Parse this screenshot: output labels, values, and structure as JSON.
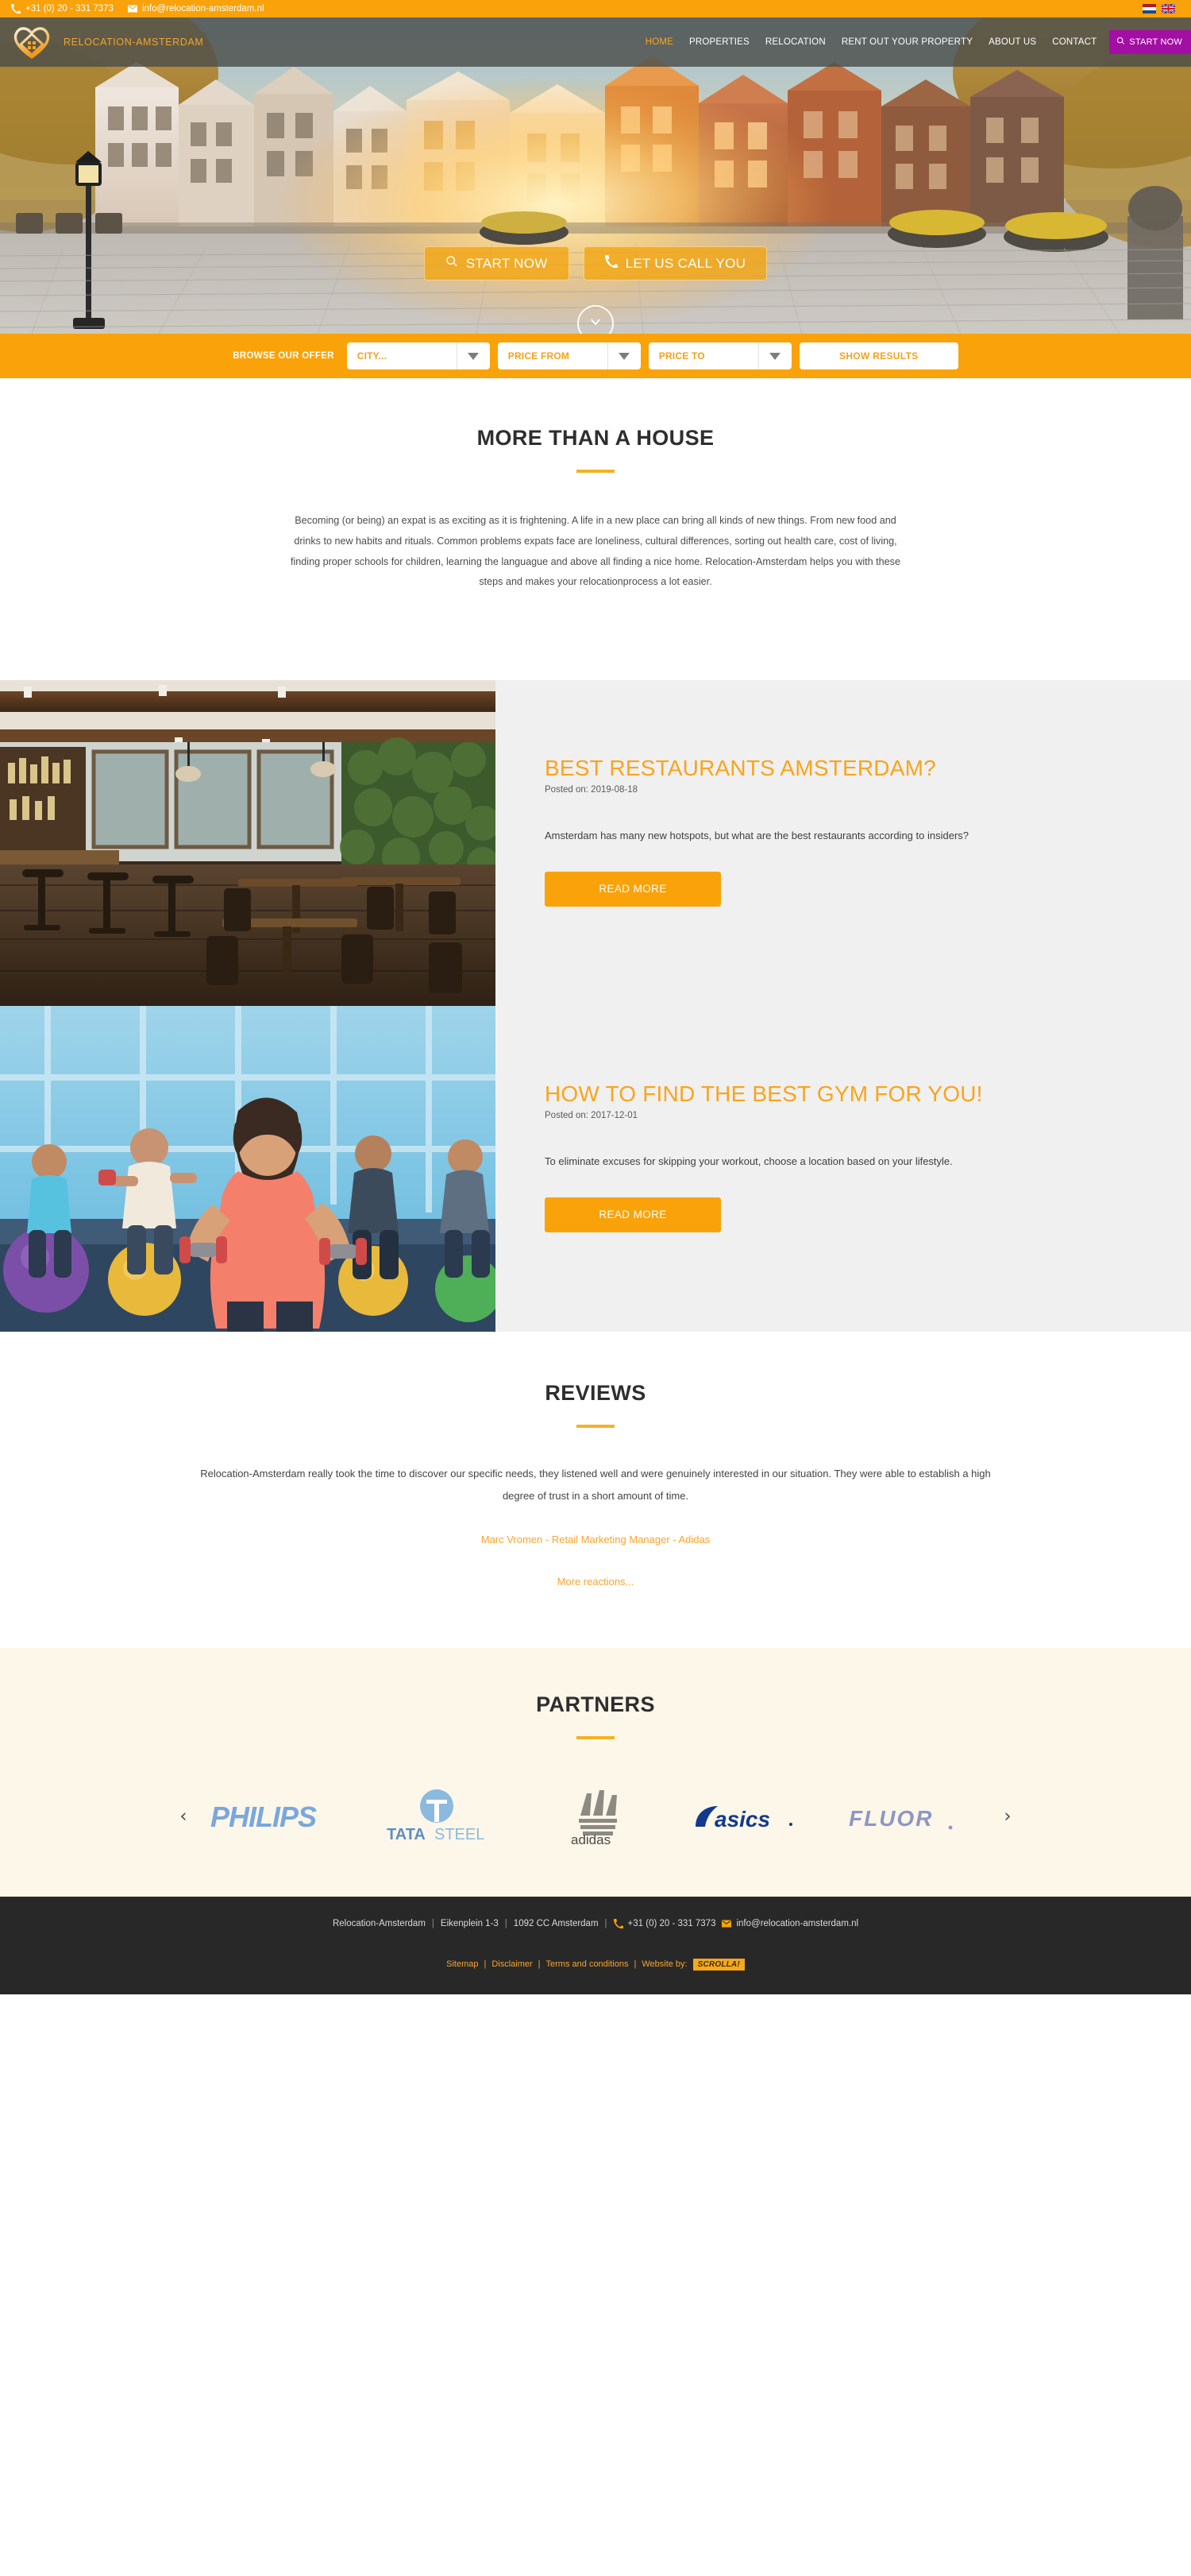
{
  "topbar": {
    "phone": "+31 (0) 20 - 331 7373",
    "email": "info@relocation-amsterdam.nl",
    "phone_icon": "phone-icon",
    "email_icon": "envelope-icon",
    "flags": [
      {
        "name": "flag-nl",
        "title": "Nederlands"
      },
      {
        "name": "flag-en",
        "title": "English"
      }
    ]
  },
  "header": {
    "logo_text": "RELOCATION-AMSTERDAM",
    "nav": [
      {
        "label": "HOME",
        "active": true
      },
      {
        "label": "PROPERTIES",
        "active": false
      },
      {
        "label": "RELOCATION",
        "active": false
      },
      {
        "label": "RENT OUT YOUR PROPERTY",
        "active": false
      },
      {
        "label": "ABOUT US",
        "active": false
      },
      {
        "label": "CONTACT",
        "active": false
      }
    ],
    "cta_label": "START NOW",
    "cta_icon": "search-icon",
    "cta_color": "#a30ea3"
  },
  "hero": {
    "primary_button": {
      "label": "START NOW",
      "icon": "search-icon"
    },
    "secondary_button": {
      "label": "LET US CALL YOU",
      "icon": "phone-icon"
    },
    "scroll_icon": "chevron-down-icon"
  },
  "searchbar": {
    "label": "BROWSE OUR OFFER",
    "fields": [
      {
        "name": "city-select",
        "value": "CITY..."
      },
      {
        "name": "price-from-select",
        "value": "PRICE FROM"
      },
      {
        "name": "price-to-select",
        "value": "PRICE TO"
      }
    ],
    "submit_label": "SHOW RESULTS",
    "accent": "#faa20a"
  },
  "intro": {
    "title": "MORE THAN A HOUSE",
    "body": "Becoming (or being) an expat is as exciting as it is frightening. A life in a new place can bring all kinds of new things. From new food and drinks to new habits and rituals. Common problems expats face are loneliness, cultural differences, sorting out health care, cost of living, finding proper schools for children, learning the languague and above all finding a nice home. Relocation-Amsterdam helps you with these steps and makes your relocationprocess a lot easier."
  },
  "blog": {
    "posts": [
      {
        "title": "BEST RESTAURANTS AMSTERDAM?",
        "date_label": "Posted on: 2019-08-18",
        "excerpt": "Amsterdam has many new hotspots, but what are the best restaurants according to insiders?",
        "button_label": "READ MORE",
        "image_name": "restaurant-interior-photo"
      },
      {
        "title": "HOW TO FIND THE BEST GYM FOR YOU!",
        "date_label": "Posted on: 2017-12-01",
        "excerpt": "To eliminate excuses for skipping your workout, choose a location based on your lifestyle.",
        "button_label": "READ MORE",
        "image_name": "gym-workout-photo"
      }
    ]
  },
  "reviews": {
    "title": "REVIEWS",
    "quote": "Relocation-Amsterdam really took the time to discover our specific needs, they listened well and were genuinely interested in our situation. They were able to establish a high degree of trust in a short amount of time.",
    "author": "Marc Vromen - Retail Marketing Manager - Adidas",
    "more_label": "More reactions..."
  },
  "partners": {
    "title": "PARTNERS",
    "prev_icon": "chevron-left-icon",
    "next_icon": "chevron-right-icon",
    "logos": [
      {
        "name": "philips-logo",
        "label": "PHILIPS"
      },
      {
        "name": "tata-steel-logo",
        "label": "TATA STEEL"
      },
      {
        "name": "adidas-logo",
        "label": "adidas"
      },
      {
        "name": "asics-logo",
        "label": "asics"
      },
      {
        "name": "fluor-logo",
        "label": "FLUOR"
      }
    ]
  },
  "footer": {
    "company": "Relocation-Amsterdam",
    "street": "Eikenplein 1-3",
    "city": "1092 CC Amsterdam",
    "phone": "+31 (0) 20 - 331 7373",
    "email": "info@relocation-amsterdam.nl",
    "links": [
      {
        "label": "Sitemap"
      },
      {
        "label": "Disclaimer"
      },
      {
        "label": "Terms and conditions"
      }
    ],
    "website_by_label": "Website by:",
    "website_by_brand": "SCROLLA!"
  }
}
